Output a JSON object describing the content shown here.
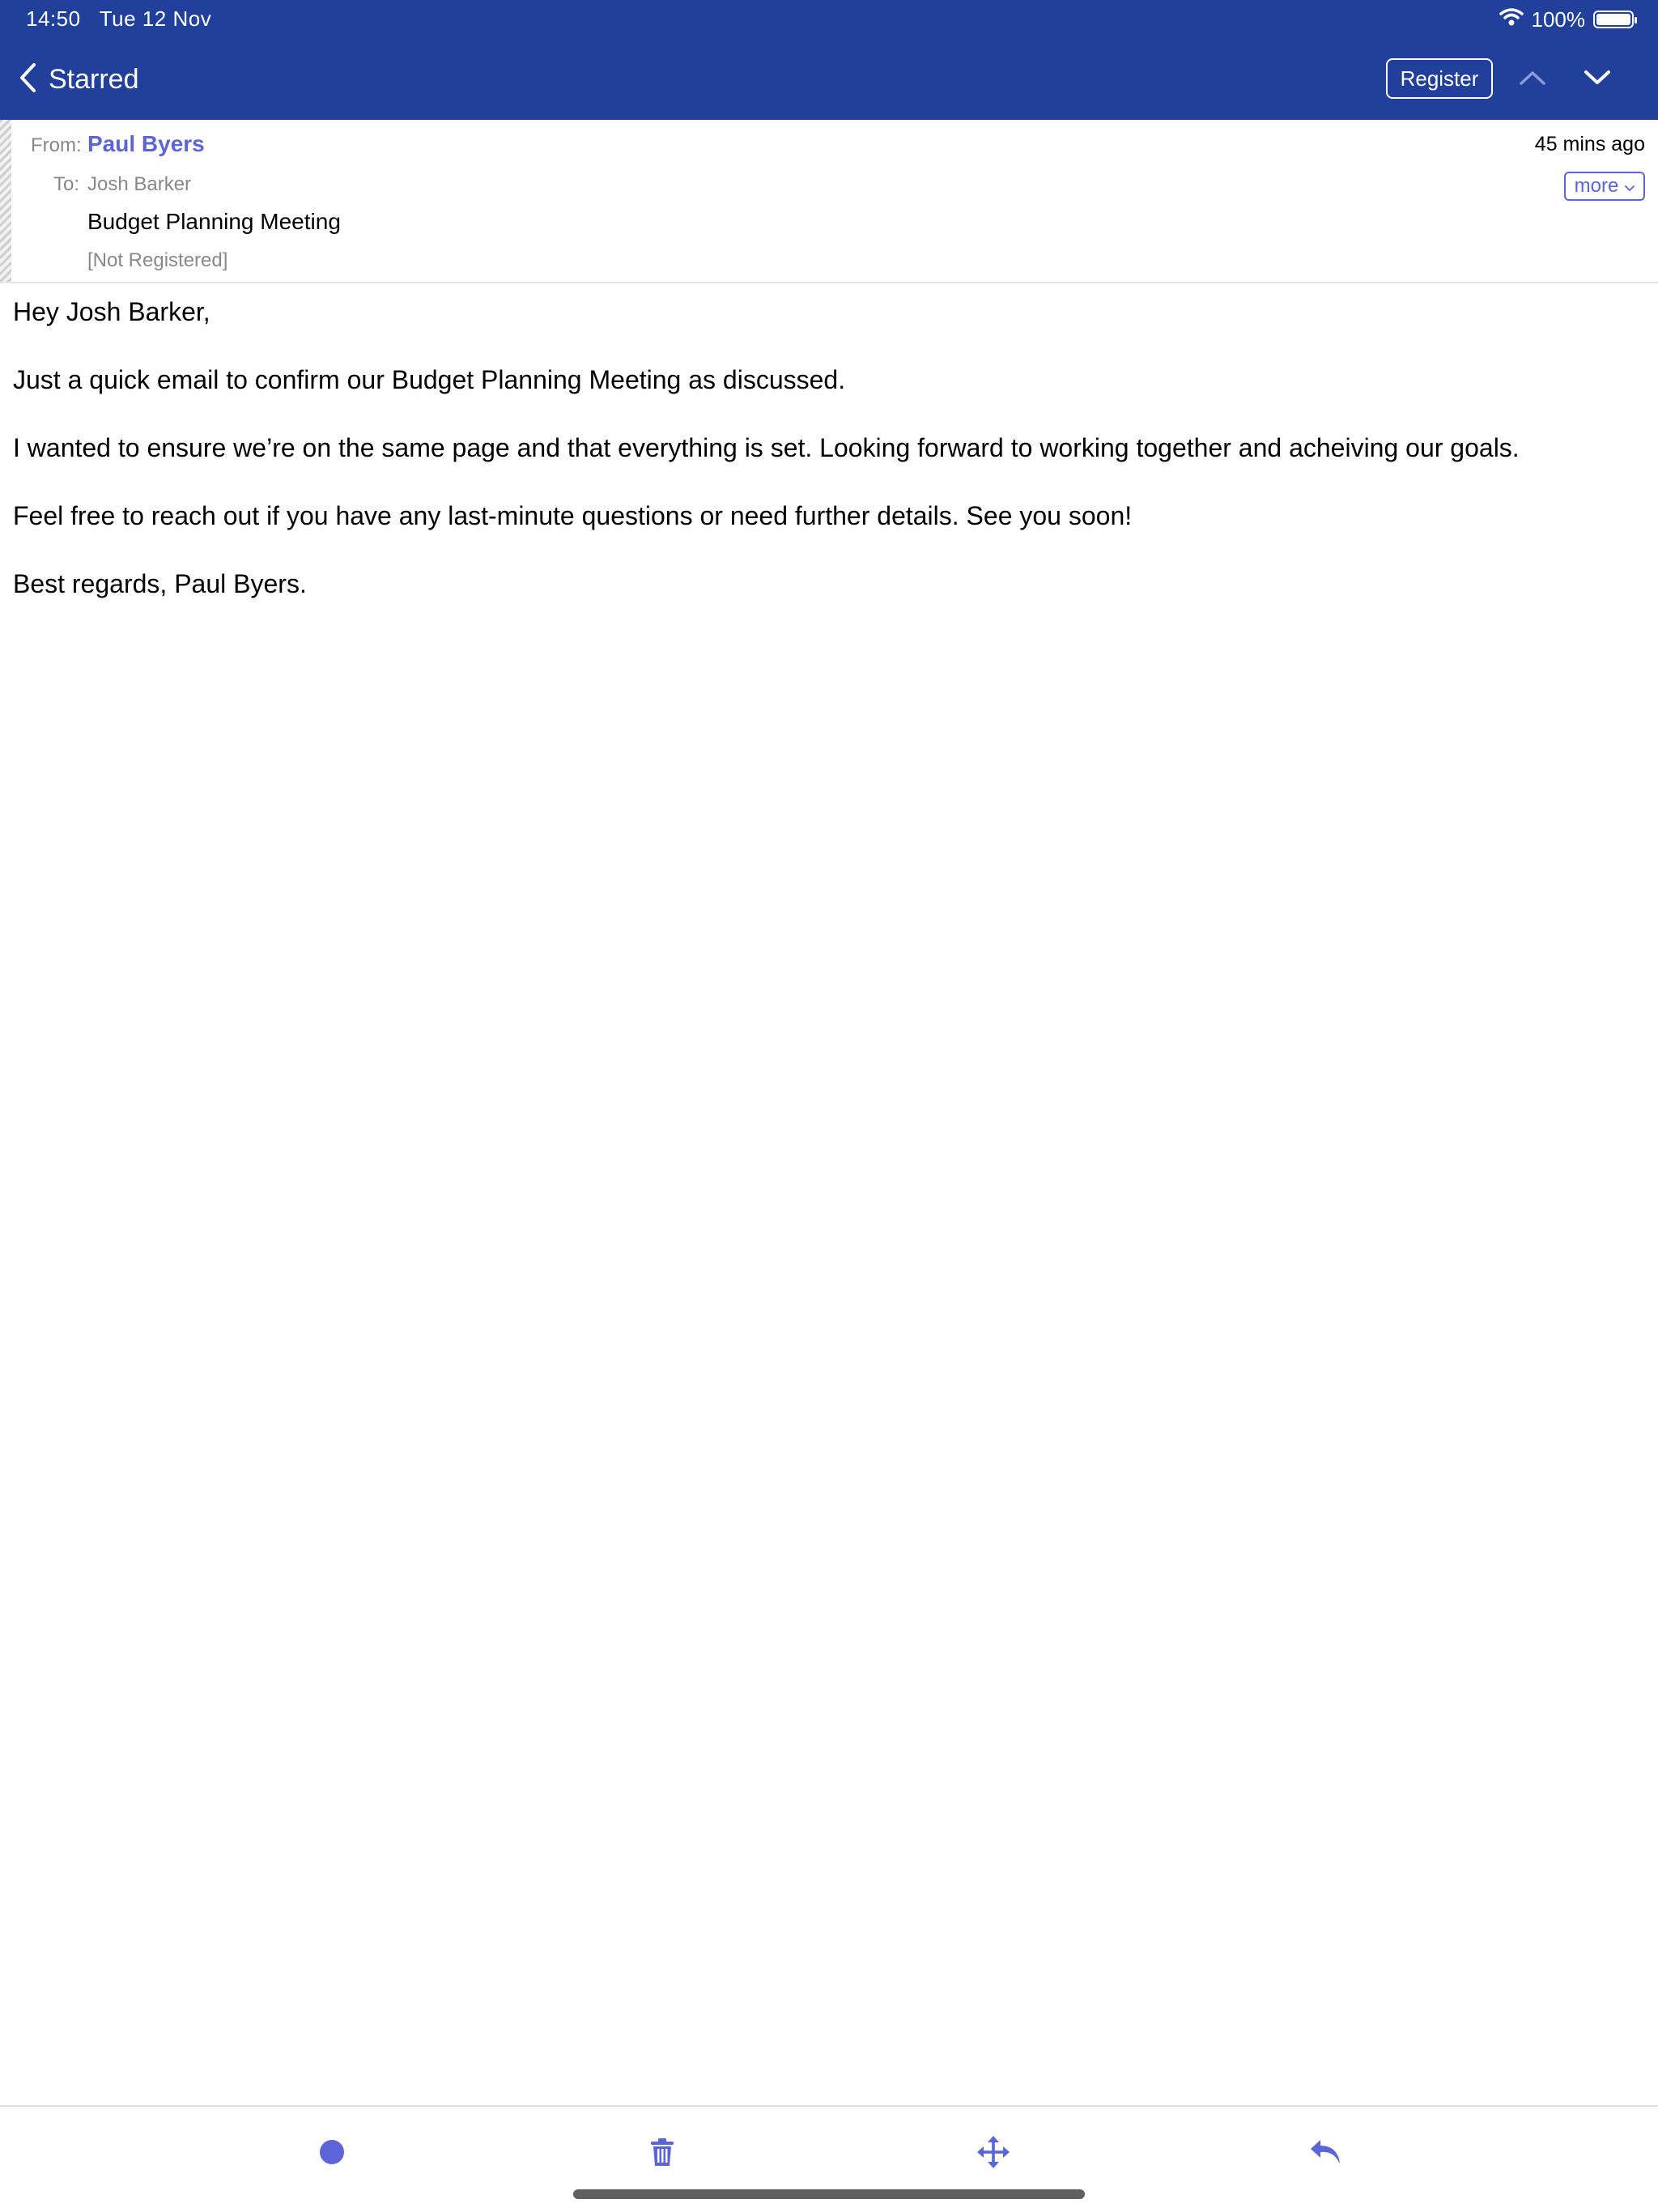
{
  "status_bar": {
    "time": "14:50",
    "date": "Tue 12 Nov",
    "battery": "100%",
    "icons": [
      "wifi-icon",
      "battery-icon"
    ]
  },
  "nav": {
    "back_label": "Starred",
    "register_label": "Register",
    "icons": [
      "chevron-left-icon",
      "chevron-up-icon",
      "chevron-down-icon"
    ]
  },
  "email": {
    "from_label": "From:",
    "from_name": "Paul Byers",
    "to_label": "To:",
    "to_name": "Josh Barker",
    "subject": "Budget Planning Meeting",
    "registration_status": "[Not Registered]",
    "timestamp": "45 mins ago",
    "more_label": "more",
    "body": [
      "Hey Josh Barker,",
      "Just a quick email to confirm our Budget Planning Meeting as discussed.",
      "I wanted to ensure we’re on the same page and that everything is set. Looking forward to working together and acheiving our goals.",
      "Feel free to reach out if you have any last-minute questions or need further details. See you soon!",
      "Best regards, Paul Byers."
    ]
  },
  "toolbar": {
    "icons": [
      "unread-dot-icon",
      "trash-icon",
      "move-icon",
      "reply-icon"
    ]
  },
  "colors": {
    "header_blue": "#21409b",
    "accent": "#5b64d9",
    "secondary_text": "#888888"
  }
}
